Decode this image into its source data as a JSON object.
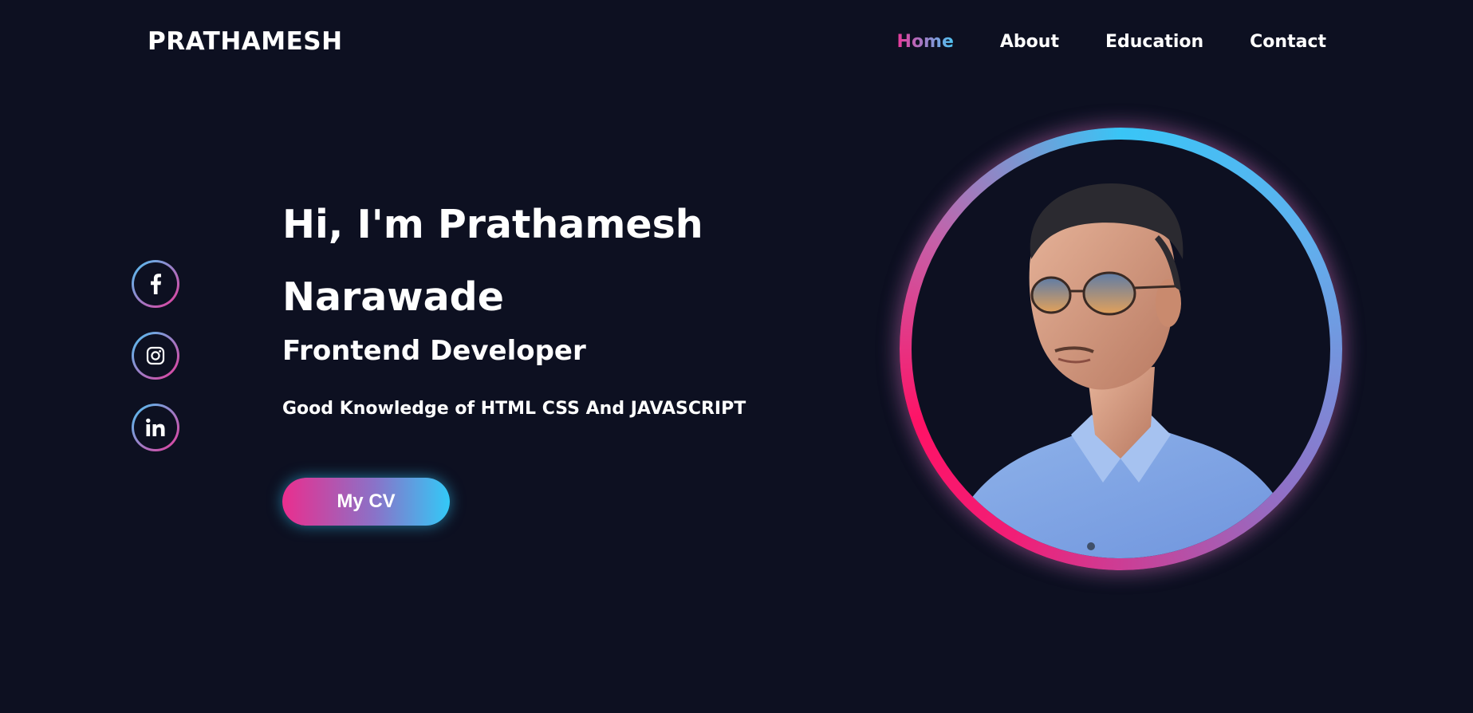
{
  "logo": "PRATHAMESH",
  "nav": [
    {
      "label": "Home",
      "active": true
    },
    {
      "label": "About",
      "active": false
    },
    {
      "label": "Education",
      "active": false
    },
    {
      "label": "Contact",
      "active": false
    }
  ],
  "socials": [
    {
      "icon": "facebook-icon"
    },
    {
      "icon": "instagram-icon"
    },
    {
      "icon": "linkedin-icon"
    }
  ],
  "hero": {
    "greeting_line1": "Hi, I'm Prathamesh",
    "greeting_line2": "Narawade",
    "role": "Frontend Developer",
    "description": "Good Knowledge of HTML CSS And JAVASCRIPT",
    "cv_button": "My CV"
  },
  "colors": {
    "background": "#0d1021",
    "accent_pink": "#e8399a",
    "accent_blue": "#33c9f7"
  }
}
